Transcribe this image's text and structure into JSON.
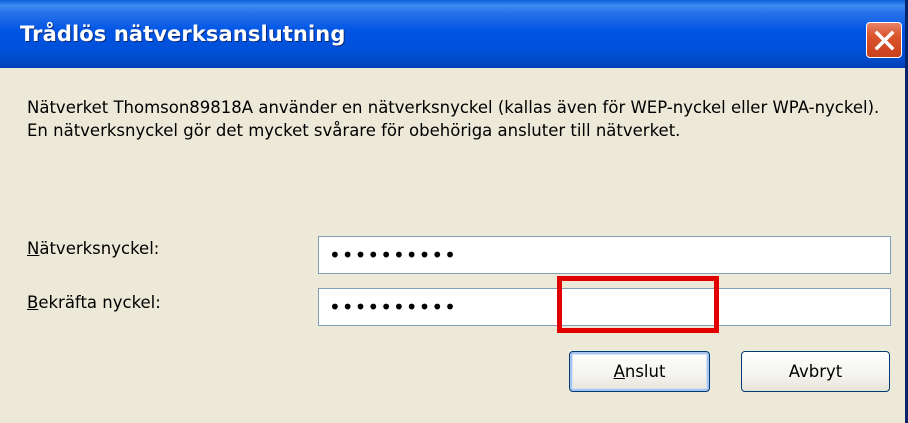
{
  "window": {
    "title": "Trådlös nätverksanslutning"
  },
  "titlebar": {
    "close_icon": "close-icon"
  },
  "dialog": {
    "description": "Nätverket Thomson89818A använder en nätverksnyckel (kallas även för WEP-nyckel eller WPA-nyckel). En nätverksnyckel gör det mycket svårare för obehöriga ansluter till nätverket.",
    "network_key_label_mnemonic": "N",
    "network_key_label_rest": "ätverksnyckel:",
    "network_key_value": "••••••••••",
    "confirm_key_label_mnemonic": "B",
    "confirm_key_label_rest": "ekräfta nyckel:",
    "confirm_key_value": "••••••••••",
    "connect_button_mnemonic": "A",
    "connect_button_rest": "nslut",
    "cancel_button_label": "Avbryt"
  },
  "colors": {
    "titlebar": "#0055E5",
    "dialog_background": "#ECE9D8",
    "close_button": "#D9532B",
    "highlight": "#E00000"
  }
}
